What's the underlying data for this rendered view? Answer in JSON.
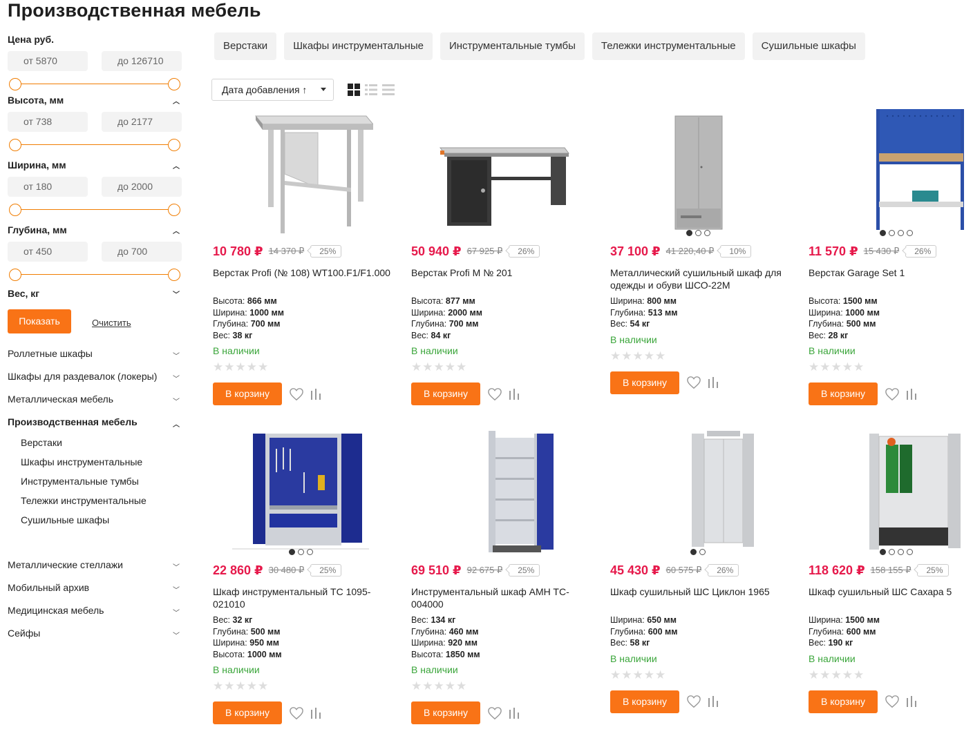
{
  "page_title": "Производственная мебель",
  "filters": {
    "price": {
      "label": "Цена руб.",
      "from": "от  5870",
      "to": "до  126710"
    },
    "height": {
      "label": "Высота, мм",
      "from": "от  738",
      "to": "до  2177"
    },
    "width": {
      "label": "Ширина, мм",
      "from": "от  180",
      "to": "до  2000"
    },
    "depth": {
      "label": "Глубина, мм",
      "from": "от  450",
      "to": "до  700"
    },
    "weight": {
      "label": "Вес, кг"
    },
    "show_label": "Показать",
    "clear_label": "Очистить"
  },
  "categories": {
    "top": [
      "Роллетные шкафы",
      "Шкафы для раздевалок (локеры)",
      "Металлическая мебель"
    ],
    "active": "Производственная мебель",
    "sub": [
      "Верстаки",
      "Шкафы инструментальные",
      "Инструментальные тумбы",
      "Тележки инструментальные",
      "Сушильные шкафы"
    ],
    "bottom": [
      "Металлические стеллажи",
      "Мобильный архив",
      "Медицинская мебель",
      "Сейфы"
    ]
  },
  "chips": [
    "Верстаки",
    "Шкафы инструментальные",
    "Инструментальные тумбы",
    "Тележки инструментальные",
    "Сушильные шкафы"
  ],
  "sort": {
    "label": "Дата добавления ↑"
  },
  "cart_label": "В корзину",
  "products": [
    {
      "price": "10 780 ₽",
      "old": "14 370 ₽",
      "disc": "25%",
      "name": "Верстак Profi (№ 108) WT100.F1/F1.000",
      "specs": [
        [
          "Высота:",
          "866 мм"
        ],
        [
          "Ширина:",
          "1000 мм"
        ],
        [
          "Глубина:",
          "700 мм"
        ],
        [
          "Вес:",
          "38 кг"
        ]
      ],
      "stock": "В наличии"
    },
    {
      "price": "50 940 ₽",
      "old": "67 925 ₽",
      "disc": "26%",
      "name": "Верстак Profi M № 201",
      "specs": [
        [
          "Высота:",
          "877 мм"
        ],
        [
          "Ширина:",
          "2000 мм"
        ],
        [
          "Глубина:",
          "700 мм"
        ],
        [
          "Вес:",
          "84 кг"
        ]
      ],
      "stock": "В наличии"
    },
    {
      "price": "37 100 ₽",
      "old": "41 220,40 ₽",
      "disc": "10%",
      "name": "Металлический сушильный шкаф для одежды и обуви ШСО-22М",
      "specs": [
        [
          "Ширина:",
          "800 мм"
        ],
        [
          "Глубина:",
          "513 мм"
        ],
        [
          "Вес:",
          "54 кг"
        ]
      ],
      "stock": "В наличии"
    },
    {
      "price": "11 570 ₽",
      "old": "15 430 ₽",
      "disc": "26%",
      "name": "Верстак Garage Set 1",
      "specs": [
        [
          "Высота:",
          "1500 мм"
        ],
        [
          "Ширина:",
          "1000 мм"
        ],
        [
          "Глубина:",
          "500 мм"
        ],
        [
          "Вес:",
          "28 кг"
        ]
      ],
      "stock": "В наличии"
    },
    {
      "price": "22 860 ₽",
      "old": "30 480 ₽",
      "disc": "25%",
      "name": "Шкаф инструментальный ТС 1095-021010",
      "specs": [
        [
          "Вес:",
          "32 кг"
        ],
        [
          "Глубина:",
          "500 мм"
        ],
        [
          "Ширина:",
          "950 мм"
        ],
        [
          "Высота:",
          "1000 мм"
        ]
      ],
      "stock": "В наличии"
    },
    {
      "price": "69 510 ₽",
      "old": "92 675 ₽",
      "disc": "25%",
      "name": "Инструментальный шкаф AMH TC-004000",
      "specs": [
        [
          "Вес:",
          "134 кг"
        ],
        [
          "Глубина:",
          "460 мм"
        ],
        [
          "Ширина:",
          "920 мм"
        ],
        [
          "Высота:",
          "1850 мм"
        ]
      ],
      "stock": "В наличии"
    },
    {
      "price": "45 430 ₽",
      "old": "60 575 ₽",
      "disc": "26%",
      "name": "Шкаф сушильный ШС Циклон 1965",
      "specs": [
        [
          "Ширина:",
          "650 мм"
        ],
        [
          "Глубина:",
          "600 мм"
        ],
        [
          "Вес:",
          "58 кг"
        ]
      ],
      "stock": "В наличии"
    },
    {
      "price": "118 620 ₽",
      "old": "158 155 ₽",
      "disc": "25%",
      "name": "Шкаф сушильный ШС Сахара 5",
      "specs": [
        [
          "Ширина:",
          "1500 мм"
        ],
        [
          "Глубина:",
          "600 мм"
        ],
        [
          "Вес:",
          "190 кг"
        ]
      ],
      "stock": "В наличии"
    }
  ],
  "colors": {
    "accent": "#f97316",
    "price": "#e6194b",
    "stock": "#3aa53a"
  }
}
